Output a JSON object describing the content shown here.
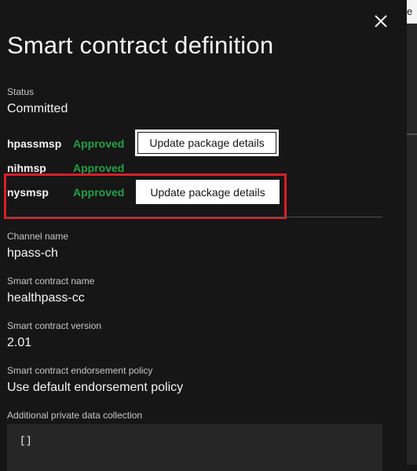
{
  "panel": {
    "title": "Smart contract definition",
    "close_icon": "close-icon"
  },
  "status": {
    "label": "Status",
    "value": "Committed"
  },
  "organizations": [
    {
      "msp": "hpassmsp",
      "status": "Approved",
      "button": "Update package details"
    },
    {
      "msp": "nihmsp",
      "status": "Approved",
      "button": ""
    },
    {
      "msp": "nysmsp",
      "status": "Approved",
      "button": "Update package details"
    }
  ],
  "details": {
    "channel_label": "Channel name",
    "channel_value": "hpass-ch",
    "contract_name_label": "Smart contract name",
    "contract_name_value": "healthpass-cc",
    "version_label": "Smart contract version",
    "version_value": "2.01",
    "policy_label": "Smart contract endorsement policy",
    "policy_value": "Use default endorsement policy",
    "private_data_label": "Additional private data collection",
    "private_data_value": "[]"
  },
  "background": {
    "edge_text": "e"
  },
  "colors": {
    "panel_bg": "#161616",
    "approved": "#24a148",
    "highlight": "#da1e28"
  }
}
